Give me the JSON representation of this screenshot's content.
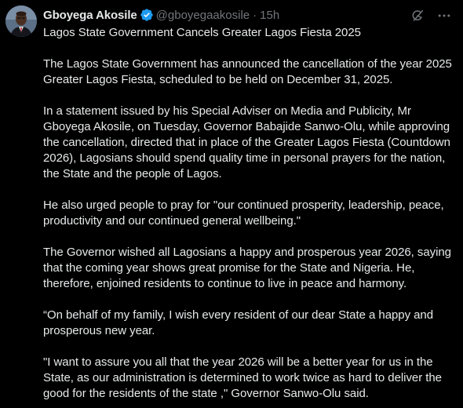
{
  "author": {
    "name": "Gboyega Akosile",
    "handle": "@gboyegaakosile",
    "separator": "·",
    "time": "15h",
    "verified_icon": "verified-badge-icon",
    "accent": "#1d9bf0"
  },
  "actions": {
    "grok_icon": "grok-icon",
    "more_icon": "more-options-icon"
  },
  "tweet": {
    "title": "Lagos State Government Cancels Greater Lagos Fiesta 2025",
    "p1": "The Lagos State Government has announced the cancellation of the year 2025 Greater Lagos Fiesta, scheduled to be held on December 31, 2025.",
    "p2": "In a statement issued by his Special Adviser on Media and Publicity, Mr Gboyega Akosile, on Tuesday, Governor Babajide Sanwo-Olu, while approving the cancellation, directed that in place of the Greater Lagos Fiesta (Countdown 2026), Lagosians should spend quality time in personal prayers for the nation, the State and the people of Lagos.",
    "p3": "He also urged people to pray for \"our continued prosperity, leadership, peace, productivity and our continued general wellbeing.\"",
    "p4": "The Governor wished all Lagosians a happy and prosperous year 2026, saying that the coming year shows great promise for the State and Nigeria. He, therefore, enjoined residents to continue to live in peace and harmony.",
    "p5": "“On behalf of my family, I wish every resident of our dear State a happy and prosperous new year.",
    "p6": "\"I want to assure you all that the year 2026 will be a better year for us in the State, as our administration is determined to work twice as hard to deliver the good for the residents of the state ,\" Governor Sanwo-Olu said."
  },
  "colors": {
    "background": "#000000",
    "text": "#e7e9ea",
    "secondary": "#71767b"
  }
}
